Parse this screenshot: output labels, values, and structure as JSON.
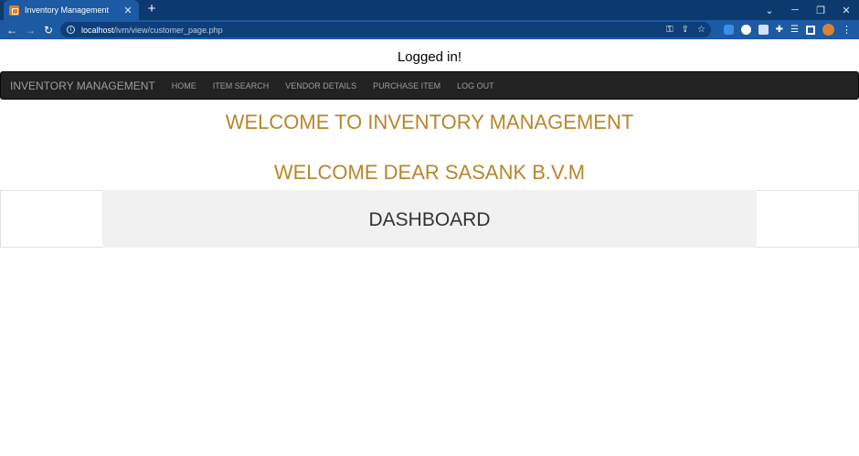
{
  "browser": {
    "tab_title": "Inventory Management",
    "url_host": "localhost",
    "url_path": "/ivm/view/customer_page.php"
  },
  "page": {
    "status": "Logged in!",
    "navbar": {
      "brand": "INVENTORY MANAGEMENT",
      "links": [
        "HOME",
        "ITEM SEARCH",
        "VENDOR DETAILS",
        "PURCHASE ITEM",
        "LOG OUT"
      ]
    },
    "welcome_title": "WELCOME TO INVENTORY MANAGEMENT",
    "welcome_user": "WELCOME DEAR SASANK B.V.M",
    "dashboard_title": "DASHBOARD"
  },
  "colors": {
    "chrome_dark": "#0d3a6e",
    "chrome_toolbar": "#1d5aa4",
    "navbar_bg": "#222222",
    "navbar_text": "#9d9d9d",
    "heading_gold": "#b8862b",
    "dashboard_bg": "#f1f1f1"
  }
}
